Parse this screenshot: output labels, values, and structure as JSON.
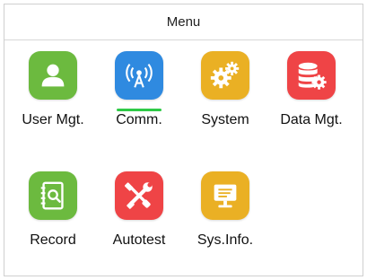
{
  "header": {
    "title": "Menu"
  },
  "menu": {
    "items": [
      {
        "label": "User Mgt.",
        "icon": "user-icon",
        "color": "#6cba3f"
      },
      {
        "label": "Comm.",
        "icon": "antenna-icon",
        "color": "#2f8ae0",
        "selected": true
      },
      {
        "label": "System",
        "icon": "gears-icon",
        "color": "#eab024"
      },
      {
        "label": "Data Mgt.",
        "icon": "database-icon",
        "color": "#ef4446"
      },
      {
        "label": "Record",
        "icon": "record-book-icon",
        "color": "#6cba3f"
      },
      {
        "label": "Autotest",
        "icon": "wrench-screwdriver-icon",
        "color": "#ef4446"
      },
      {
        "label": "Sys.Info.",
        "icon": "monitor-icon",
        "color": "#eab024"
      }
    ]
  },
  "colors": {
    "selection_indicator": "#2fca47"
  }
}
